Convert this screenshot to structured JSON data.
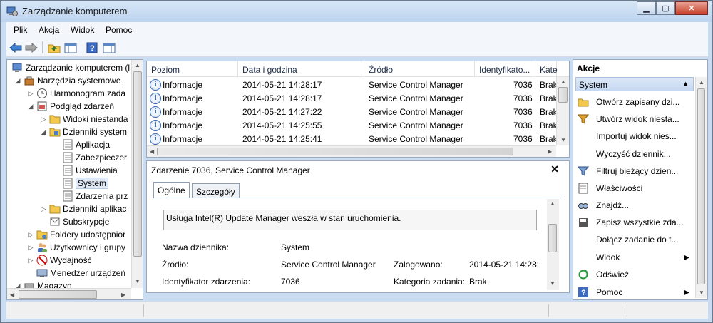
{
  "window": {
    "title": "Zarządzanie komputerem"
  },
  "menu": [
    "Plik",
    "Akcja",
    "Widok",
    "Pomoc"
  ],
  "tree": [
    {
      "label": "Zarządzanie komputerem (l",
      "icon": "computer-icon"
    },
    {
      "label": "Narzędzia systemowe",
      "icon": "tools-icon"
    },
    {
      "label": "Harmonogram zada",
      "icon": "clock-icon"
    },
    {
      "label": "Podgląd zdarzeń",
      "icon": "event-viewer-icon"
    },
    {
      "label": "Widoki niestanda",
      "icon": "folder-icon"
    },
    {
      "label": "Dzienniki system",
      "icon": "logs-folder-icon"
    },
    {
      "label": "Aplikacja",
      "icon": "log-icon"
    },
    {
      "label": "Zabezpieczer",
      "icon": "log-icon"
    },
    {
      "label": "Ustawienia",
      "icon": "log-icon"
    },
    {
      "label": "System",
      "icon": "log-icon"
    },
    {
      "label": "Zdarzenia prz",
      "icon": "log-icon"
    },
    {
      "label": "Dzienniki aplikac",
      "icon": "folder-icon"
    },
    {
      "label": "Subskrypcje",
      "icon": "subscription-icon"
    },
    {
      "label": "Foldery udostępnior",
      "icon": "shared-folder-icon"
    },
    {
      "label": "Użytkownicy i grupy",
      "icon": "users-icon"
    },
    {
      "label": "Wydajność",
      "icon": "performance-icon"
    },
    {
      "label": "Menedżer urządzeń",
      "icon": "device-manager-icon"
    },
    {
      "label": "Magazyn",
      "icon": "storage-icon"
    }
  ],
  "events": {
    "columns": [
      "Poziom",
      "Data i godzina",
      "Źródło",
      "Identyfikato...",
      "Kate"
    ],
    "rows": [
      {
        "level": "Informacje",
        "date": "2014-05-21 14:28:17",
        "source": "Service Control Manager",
        "id": "7036",
        "cat": "Brak"
      },
      {
        "level": "Informacje",
        "date": "2014-05-21 14:28:17",
        "source": "Service Control Manager",
        "id": "7036",
        "cat": "Brak"
      },
      {
        "level": "Informacje",
        "date": "2014-05-21 14:27:22",
        "source": "Service Control Manager",
        "id": "7036",
        "cat": "Brak"
      },
      {
        "level": "Informacje",
        "date": "2014-05-21 14:25:55",
        "source": "Service Control Manager",
        "id": "7036",
        "cat": "Brak"
      },
      {
        "level": "Informacje",
        "date": "2014-05-21 14:25:41",
        "source": "Service Control Manager",
        "id": "7036",
        "cat": "Brak"
      }
    ]
  },
  "detail": {
    "title": "Zdarzenie 7036, Service Control Manager",
    "tabs": [
      "Ogólne",
      "Szczegóły"
    ],
    "message": "Usługa Intel(R) Update Manager weszła w stan uruchomienia.",
    "log_name_label": "Nazwa dziennika:",
    "log_name": "System",
    "source_label": "Źródło:",
    "source": "Service Control Manager",
    "logged_label": "Zalogowano:",
    "logged": "2014-05-21 14:28:1",
    "event_id_label": "Identyfikator zdarzenia:",
    "event_id": "7036",
    "task_cat_label": "Kategoria zadania:",
    "task_cat": "Brak"
  },
  "actions": {
    "header": "Akcje",
    "section": "System",
    "items": [
      {
        "label": "Otwórz zapisany dzi...",
        "icon": "open-folder-icon"
      },
      {
        "label": "Utwórz widok niesta...",
        "icon": "filter-create-icon"
      },
      {
        "label": "Importuj widok nies...",
        "icon": ""
      },
      {
        "label": "Wyczyść dziennik...",
        "icon": ""
      },
      {
        "label": "Filtruj bieżący dzien...",
        "icon": "filter-icon"
      },
      {
        "label": "Właściwości",
        "icon": "properties-icon"
      },
      {
        "label": "Znajdź...",
        "icon": "find-icon"
      },
      {
        "label": "Zapisz wszystkie zda...",
        "icon": "save-icon"
      },
      {
        "label": "Dołącz zadanie do t...",
        "icon": ""
      },
      {
        "label": "Widok",
        "icon": ""
      },
      {
        "label": "Odśwież",
        "icon": "refresh-icon"
      },
      {
        "label": "Pomoc",
        "icon": "help-icon"
      }
    ]
  }
}
